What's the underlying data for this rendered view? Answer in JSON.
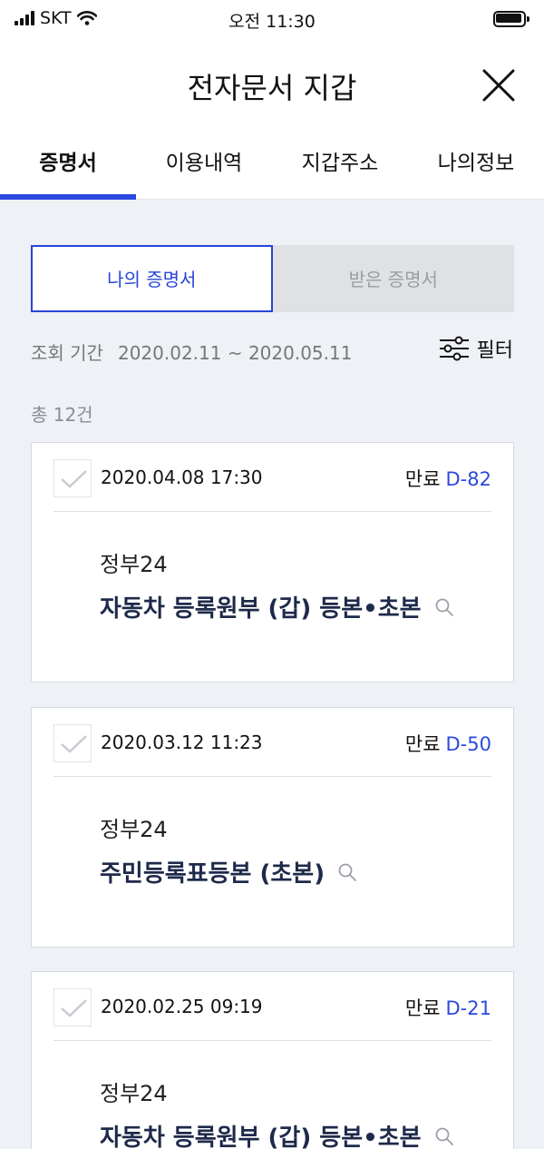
{
  "status_bar": {
    "carrier": "SKT",
    "time": "오전 11:30"
  },
  "header": {
    "title": "전자문서 지갑"
  },
  "tabs": [
    {
      "label": "증명서",
      "active": true
    },
    {
      "label": "이용내역",
      "active": false
    },
    {
      "label": "지갑주소",
      "active": false
    },
    {
      "label": "나의정보",
      "active": false
    }
  ],
  "segment": {
    "mine": "나의 증명서",
    "received": "받은 증명서"
  },
  "period": {
    "label": "조회 기간",
    "value": "2020.02.11 ~ 2020.05.11"
  },
  "filter_label": "필터",
  "total": "총 12건",
  "cards": [
    {
      "date": "2020.04.08 17:30",
      "expiry_label": "만료",
      "dday": "D-82",
      "issuer": "정부24",
      "doc": "자동차 등록원부 (갑) 등본•초본"
    },
    {
      "date": "2020.03.12 11:23",
      "expiry_label": "만료",
      "dday": "D-50",
      "issuer": "정부24",
      "doc": "주민등록표등본 (초본)"
    },
    {
      "date": "2020.02.25 09:19",
      "expiry_label": "만료",
      "dday": "D-21",
      "issuer": "정부24",
      "doc": "자동차 등록원부 (갑) 등본•초본"
    }
  ],
  "colors": {
    "accent": "#2b49e0",
    "background": "#eef1f5",
    "card_title": "#1e2a4a"
  },
  "icons": {
    "close": "close-icon",
    "filter": "sliders-icon",
    "search": "search-icon",
    "check": "check-icon"
  }
}
